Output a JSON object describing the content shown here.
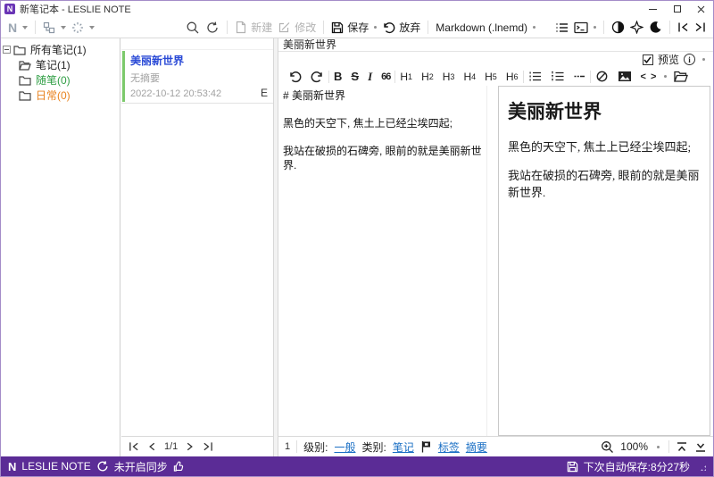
{
  "titlebar": {
    "title": "新笔记本 - LESLIE NOTE"
  },
  "toolbar": {
    "new_label": "新建",
    "edit_label": "修改",
    "save_label": "保存",
    "discard_label": "放弃",
    "format_selector": "Markdown  (.lnemd)"
  },
  "icons": {
    "app_logo": "N",
    "contrast": "◑",
    "moon": "☾",
    "collapse_left": "|<",
    "collapse_right": ">|",
    "page_first": "|<",
    "page_prev": "<",
    "page_next": ">",
    "page_last": ">|",
    "check": "✓",
    "info": "i",
    "close": "✕"
  },
  "sidebar": {
    "items": [
      {
        "label": "所有笔记(1)",
        "color": "#222222"
      },
      {
        "label": "笔记(1)",
        "color": "#222222"
      },
      {
        "label": "随笔(0)",
        "color": "#2f9e44"
      },
      {
        "label": "日常(0)",
        "color": "#e8821e"
      }
    ]
  },
  "notelist": {
    "items": [
      {
        "title": "美丽新世界",
        "summary": "无摘要",
        "date": "2022-10-12 20:53:42",
        "badge": "E"
      }
    ],
    "pagination": {
      "page": "1",
      "total": "/1"
    }
  },
  "editor": {
    "title": "美丽新世界",
    "preview_label": "预览",
    "md_toolbar": {
      "bold": "B",
      "strike": "S",
      "italic": "I",
      "quote": "66",
      "code": "< >"
    },
    "md_headings": [
      {
        "h": "H",
        "n": "1"
      },
      {
        "h": "H",
        "n": "2"
      },
      {
        "h": "H",
        "n": "3"
      },
      {
        "h": "H",
        "n": "4"
      },
      {
        "h": "H",
        "n": "5"
      },
      {
        "h": "H",
        "n": "6"
      }
    ],
    "source": "# 美丽新世界\n\n黑色的天空下, 焦土上已经尘埃四起;\n\n我站在破损的石碑旁, 眼前的就是美丽新世界.",
    "preview": {
      "heading": "美丽新世界",
      "paragraphs": [
        "黑色的天空下, 焦土上已经尘埃四起;",
        "我站在破损的石碑旁, 眼前的就是美丽新世界."
      ]
    },
    "status": {
      "line_number": "1",
      "level_label": "级别:",
      "level_value": "一般",
      "category_label": "类别:",
      "category_value": "笔记",
      "tags_label": "标签",
      "summary_label": "摘要",
      "zoom": "100%"
    }
  },
  "statusbar": {
    "app_name": "LESLIE NOTE",
    "sync_status": "未开启同步",
    "autosave": "下次自动保存:8分27秒"
  },
  "colors": {
    "accent_purple": "#5b2c96",
    "note_title_blue": "#2949d6",
    "link_blue": "#1a6fc4",
    "item_green": "#7cc96b"
  }
}
